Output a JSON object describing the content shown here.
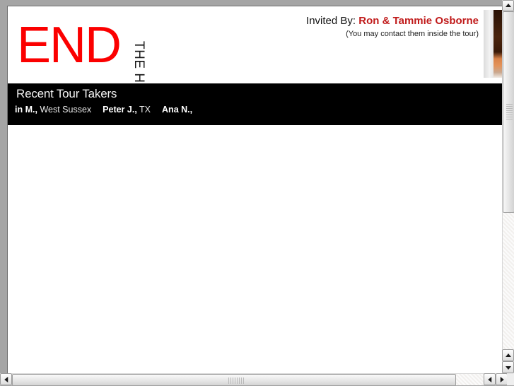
{
  "logo": {
    "main_text": "END",
    "vertical_text": "THE HYPE",
    "main_color": "#fb0000",
    "vertical_color": "#1a1a1a"
  },
  "header": {
    "invited_label": "Invited By:",
    "invited_name": "Ron & Tammie Osborne",
    "invited_name_color": "#c01a1a",
    "contact_note": "(You may contact them inside the tour)",
    "sponsor_photo": "sponsor-photo"
  },
  "ticker": {
    "title": "Recent Tour Takers",
    "background": "#000000",
    "entries": [
      {
        "name": "in M.,",
        "location": "West Sussex"
      },
      {
        "name": "Peter J.,",
        "location": "TX"
      },
      {
        "name": "Ana N.,",
        "location": ""
      }
    ]
  },
  "scrollbars": {
    "vertical": {
      "up_arrow": "triangle-up",
      "down_arrow": "triangle-down",
      "thumb": "vertical-scroll-thumb"
    },
    "horizontal": {
      "left_arrow": "triangle-left",
      "right_arrow": "triangle-right",
      "thumb": "horizontal-scroll-thumb"
    }
  }
}
